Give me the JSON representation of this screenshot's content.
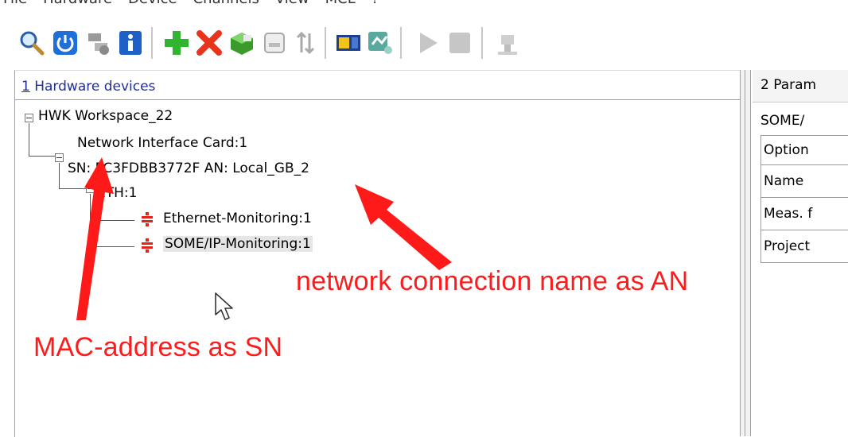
{
  "menu": {
    "items": [
      "File",
      "Hardware",
      "Device",
      "Channels",
      "View",
      "MCL",
      "?"
    ]
  },
  "toolbar": {
    "icons": [
      "search-icon",
      "power-icon",
      "disconnect-icon",
      "info-icon",
      "add-icon",
      "delete-icon",
      "module-icon",
      "device-id-icon",
      "sort-icon",
      "vehicle-interface-icon",
      "config-icon",
      "play-icon",
      "stop-icon",
      "hardware-icon"
    ]
  },
  "left_panel": {
    "title_num": "1",
    "title_text": " Hardware devices",
    "tree": {
      "root": "HWK Workspace_22",
      "nic": "Network Interface Card:1",
      "sn_line": "SN: FC3FDBB3772F AN: Local_GB_2",
      "eth": "ETH:1",
      "ch1": "Ethernet-Monitoring:1",
      "ch2": "SOME/IP-Monitoring:1"
    }
  },
  "right_panel": {
    "tab": "2 Param",
    "sub": "SOME/",
    "rows": [
      "Option",
      "Name",
      "Meas. f",
      "Project"
    ]
  },
  "annotations": {
    "an_label": "network connection name as AN",
    "sn_label": "MAC-address as SN"
  },
  "colors": {
    "annotation": "#ff1b1b",
    "title_link": "#1f2ea0"
  }
}
